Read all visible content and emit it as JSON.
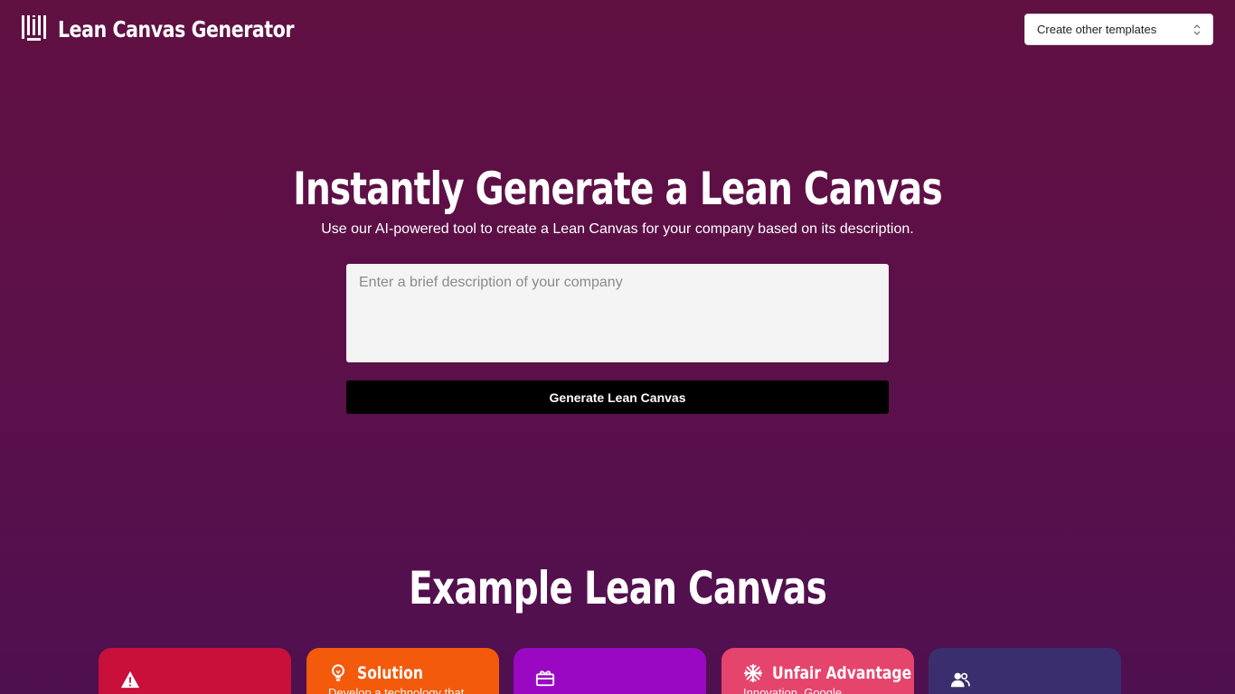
{
  "header": {
    "app_title": "Lean Canvas Generator",
    "logo_icon": "bars-logo-icon",
    "template_select": {
      "selected": "Create other templates",
      "icon": "chevron-up-down-icon"
    }
  },
  "hero": {
    "title": "Instantly Generate a Lean Canvas",
    "subtitle": "Use our AI-powered tool to create a Lean Canvas for your company based on its description.",
    "description_placeholder": "Enter a brief description of your company",
    "generate_label": "Generate Lean Canvas"
  },
  "example": {
    "title": "Example Lean Canvas",
    "cards": [
      {
        "title": "",
        "text": "",
        "icon": "warning-icon",
        "color": "#c8103a"
      },
      {
        "title": "Solution",
        "text": "Develop a technology that",
        "icon": "lightbulb-icon",
        "color": "#f35a0c"
      },
      {
        "title": "",
        "text": "",
        "icon": "gift-icon",
        "color": "#9a08c4"
      },
      {
        "title": "Unfair Advantage",
        "text": "Innovation, Google",
        "icon": "snowflake-icon",
        "color": "#e5446d"
      },
      {
        "title": "",
        "text": "",
        "icon": "users-icon",
        "color": "#3b2e6e"
      }
    ]
  },
  "colors": {
    "background": "#5c1046",
    "button": "#000000",
    "input_bg": "#f4f4f4"
  }
}
